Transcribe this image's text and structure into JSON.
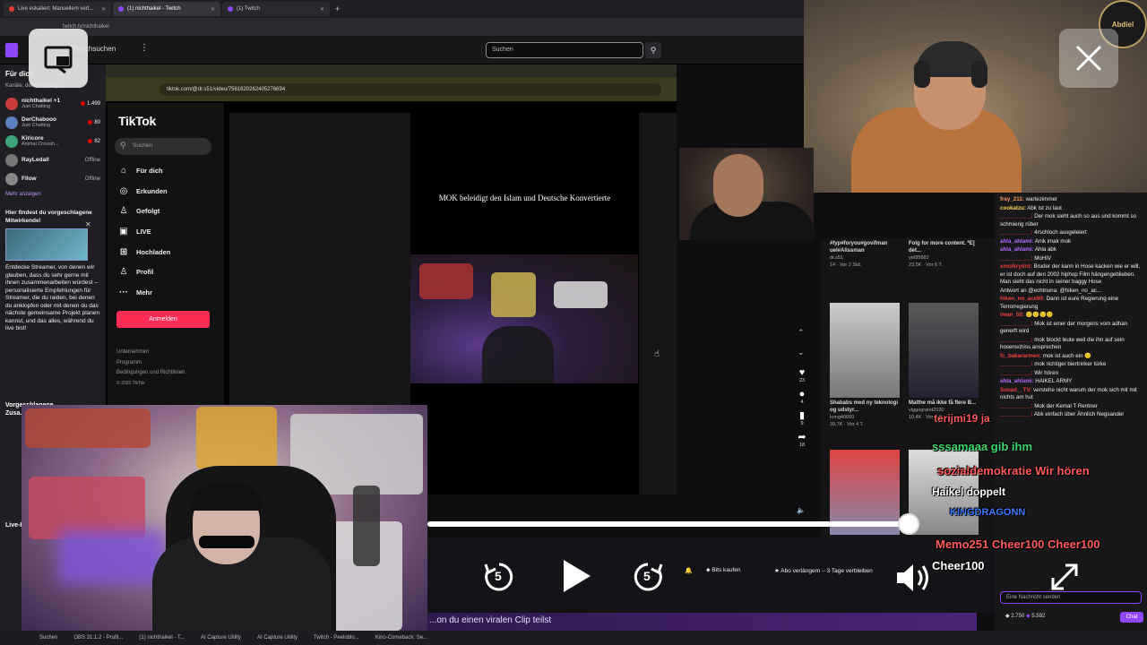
{
  "browser": {
    "tabs": [
      {
        "label": "Live eskaliert: Manuellem vert...",
        "color": "red"
      },
      {
        "label": "(1) nichthaikel - Twitch",
        "color": "purple"
      },
      {
        "label": "(1) Twitch",
        "color": "purple"
      }
    ],
    "url": "twitch.tv/nichthaikel"
  },
  "twitch": {
    "browse_label": "Durchsuchen",
    "search_placeholder": "Suchen",
    "sidebar": {
      "header": "Für dich",
      "subheader": "Kanäle, denen du folgst",
      "channels": [
        {
          "name": "nichthaikel +1",
          "game": "Just Chatting",
          "viewers": "1.499",
          "color": "#c83a3a",
          "live": true
        },
        {
          "name": "DerChabooo",
          "game": "Just Chatting",
          "viewers": "80",
          "color": "#5d7fbf",
          "live": true
        },
        {
          "name": "Kiricore",
          "game": "Animal Crossin...",
          "viewers": "82",
          "color": "#3fa37a",
          "live": true
        },
        {
          "name": "RayLedall",
          "game": "",
          "viewers": "Offline",
          "color": "#777",
          "live": false
        },
        {
          "name": "Fllow",
          "game": "",
          "viewers": "Offline",
          "color": "#888",
          "live": false
        }
      ],
      "more_link": "Mehr anzeigen",
      "promo_title": "Hier findest du vorgeschlagene Mitwirkende!",
      "promo_body": "Entdecke Streamer, von denen wir glauben, dass du sehr gerne mit ihnen zusammenarbeiten würdest – personalisierte Empfehlungen für Streamer, die du raiden, bei denen du anklopfen oder mit denen du das nächste gemeinsame Projekt planen kannst, und das alles, während du live bist!",
      "section2_title": "Vorgeschlagene",
      "section2_sub": "Zusa...",
      "section3_title": "Live-K..."
    },
    "bits_label": "Bits kaufen",
    "abo_label": "Abo verlängern – 3 Tage verbleiben",
    "purple_banner": "...on du einen viralen Clip teilst"
  },
  "tiktok": {
    "url": "tiktok.com/@dr.s51/video/7561820262405276694",
    "logo": "TikTok",
    "search_placeholder": "Suchen",
    "nav": [
      {
        "icon": "home-icon",
        "glyph": "⌂",
        "label": "Für dich"
      },
      {
        "icon": "compass-icon",
        "glyph": "◎",
        "label": "Erkunden"
      },
      {
        "icon": "following-icon",
        "glyph": "♙",
        "label": "Gefolgt"
      },
      {
        "icon": "live-icon",
        "glyph": "▣",
        "label": "LIVE"
      },
      {
        "icon": "upload-icon",
        "glyph": "⊞",
        "label": "Hochladen"
      },
      {
        "icon": "profile-icon",
        "glyph": "♙",
        "label": "Profil"
      },
      {
        "icon": "more-icon",
        "glyph": "···",
        "label": "Mehr"
      }
    ],
    "login_label": "Anmelden",
    "footer": [
      "Unternehmen",
      "Programm",
      "Bedingungen und Richtlinien",
      "© 2025 TikTok"
    ],
    "video_title": "MOK beleidigt den Islam und Deutsche Konvertierte",
    "actions": [
      {
        "icon": "heart-icon",
        "glyph": "♥",
        "count": "23"
      },
      {
        "icon": "comment-icon",
        "glyph": "●",
        "count": "4"
      },
      {
        "icon": "bookmark-icon",
        "glyph": "▮",
        "count": "9"
      },
      {
        "icon": "share-icon",
        "glyph": "➦",
        "count": "18"
      }
    ],
    "grid": [
      {
        "caption": "#fyp#foryou#govifman uel#Alissman",
        "user": "dr.s51",
        "meta": "14 · Vor 2 Std."
      },
      {
        "caption": "Folg for more content. *E] det...",
        "user": "yet95882",
        "meta": "23,5K · Vor 6 T."
      },
      {
        "caption": "Shababs med ny teknologi og udstyr...",
        "user": "kong40660",
        "meta": "39,7K · Vor 4 T."
      },
      {
        "caption": "Malthe må ikke få flere B...",
        "user": "viggogrand2020",
        "meta": "10,4K · Vor 5 T."
      }
    ]
  },
  "chat": {
    "messages": [
      {
        "user": "frey_211:",
        "text": "wartezimmer",
        "color": "#ff9d5c"
      },
      {
        "user": "cookatzu:",
        "text": "Abk ist zu laut",
        "color": "#ffd65c"
      },
      {
        "user": "__________:",
        "text": "Der mok sieht auch so aus und kommt so schmierig rüber",
        "color": "#e8403a"
      },
      {
        "user": "__________:",
        "text": "4rschloch ausgeleiert",
        "color": "#e8403a"
      },
      {
        "user": "ahla_ahlami:",
        "text": "Anik imak mok",
        "color": "#b469ff"
      },
      {
        "user": "ahla_ahlami:",
        "text": "Ahla abk",
        "color": "#b469ff"
      },
      {
        "user": "__________:",
        "text": "MoHIV",
        "color": "#e8403a"
      },
      {
        "user": "xmolkrydrd:",
        "text": "Bruder der kann in Hose kacken wie er will, er ist doch auf den 2002 hiphop Film hängengeblieben. Man sieht das nicht in seiner baggy Hose",
        "color": "#e8403a"
      },
      {
        "user": "",
        "text": "Antwort an @echtnuna: @hiken_no_ac...",
        "color": "#adadb8"
      },
      {
        "user": "hiken_no_ace99:",
        "text": "Dann ist eure Regierung eine Terrorregierung",
        "color": "#e8403a"
      },
      {
        "user": "iman_50:",
        "text": "🙂🙂🙂🙂",
        "color": "#e8403a"
      },
      {
        "user": "__________:",
        "text": "Mok ist einer der morgens vom adhan generft wird",
        "color": "#e8403a"
      },
      {
        "user": "__________:",
        "text": "mok blockt leute weil die ihn auf sein hosenschiss ansprechen",
        "color": "#e8403a"
      },
      {
        "user": "fc_bakararmen:",
        "text": "mok ist auch ein 🙂",
        "color": "#e8403a"
      },
      {
        "user": "__________:",
        "text": "mok richtiger biertrinker türke",
        "color": "#e8403a"
      },
      {
        "user": "__________:",
        "text": "Wir hören",
        "color": "#e8403a"
      },
      {
        "user": "ahla_ahlami:",
        "text": "HAIKEL ARMY",
        "color": "#b469ff"
      },
      {
        "user": "Sonad__TV:",
        "text": "verstehe nicht warum der mok sich mit mit nichts am hut",
        "color": "#e8403a"
      },
      {
        "user": "__________:",
        "text": "Mok der Kemal T Rentner",
        "color": "#e8403a"
      },
      {
        "user": "__________:",
        "text": "Abk einfach über Ähnlich Negsander",
        "color": "#e8403a"
      }
    ],
    "input_placeholder": "Eine Nachricht senden",
    "send_label": "Chat",
    "points": "2.750",
    "points2": "5.592"
  },
  "emotes": [
    {
      "text": "terijmi19 ja",
      "color": "#ff5a5a"
    },
    {
      "text": "sssamaaa gib ihm",
      "color": "#3cd96a"
    },
    {
      "text": "sozialdemokratie Wir hören",
      "color": "#ff5a5a"
    },
    {
      "text": "Haikel doppelt",
      "color": "#ffffff"
    },
    {
      "text": "KINGDRAGONN",
      "color": "#3a7bff"
    },
    {
      "text": "Memo251 Cheer100 Cheer100",
      "color": "#ff5a5a"
    },
    {
      "text": "Cheer100",
      "color": "#ffffff"
    }
  ],
  "overlay": {
    "progress": 0.93,
    "rewind_seconds": "5",
    "forward_seconds": "5"
  },
  "cams": {
    "badge": "Abdiel",
    "guest_label": "",
    "host_label": ""
  },
  "taskbar": {
    "items": [
      "Suchen",
      "OBS 31.1.2 - Profil...",
      "(1) nichthaikel - T...",
      "AI Capture Utility",
      "AI Capture Utility",
      "Twitch - Peeloblo...",
      "Kino-Comeback: Se..."
    ]
  },
  "colors": {
    "twitch_purple": "#9146ff",
    "tiktok_red": "#fe2c55",
    "live_red": "#eb0400"
  }
}
